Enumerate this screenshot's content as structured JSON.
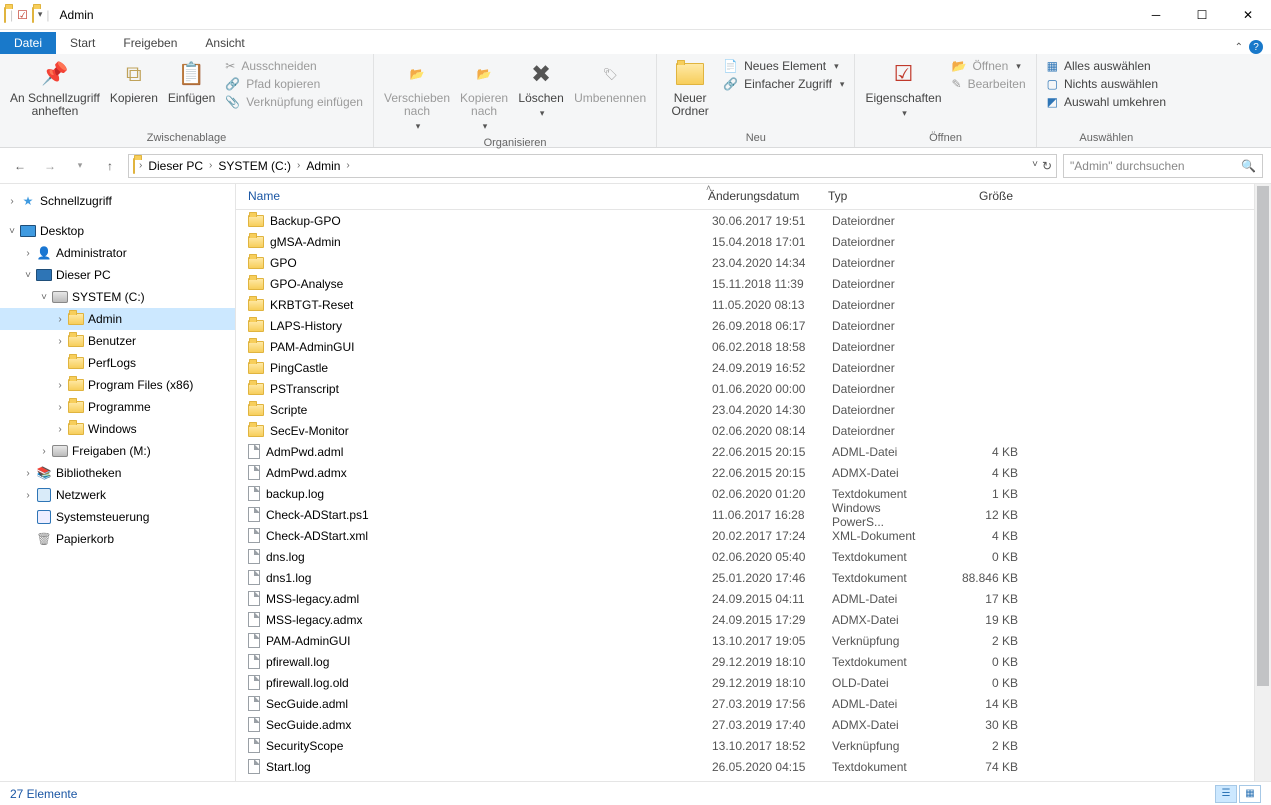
{
  "window": {
    "title": "Admin"
  },
  "tabs": {
    "file": "Datei",
    "start": "Start",
    "share": "Freigeben",
    "view": "Ansicht"
  },
  "ribbon": {
    "clipboard": {
      "label": "Zwischenablage",
      "pin": "An Schnellzugriff\nanheften",
      "copy": "Kopieren",
      "paste": "Einfügen",
      "cut": "Ausschneiden",
      "copypath": "Pfad kopieren",
      "pastesc": "Verknüpfung einfügen"
    },
    "organize": {
      "label": "Organisieren",
      "move": "Verschieben\nnach",
      "copyto": "Kopieren\nnach",
      "delete": "Löschen",
      "rename": "Umbenennen"
    },
    "new": {
      "label": "Neu",
      "newfolder": "Neuer\nOrdner",
      "newitem": "Neues Element",
      "easyaccess": "Einfacher Zugriff"
    },
    "open": {
      "label": "Öffnen",
      "props": "Eigenschaften",
      "open": "Öffnen",
      "edit": "Bearbeiten"
    },
    "select": {
      "label": "Auswählen",
      "all": "Alles auswählen",
      "none": "Nichts auswählen",
      "invert": "Auswahl umkehren"
    }
  },
  "breadcrumb": [
    "Dieser PC",
    "SYSTEM (C:)",
    "Admin"
  ],
  "search_placeholder": "\"Admin\" durchsuchen",
  "tree": [
    {
      "d": 1,
      "tw": ">",
      "ic": "star",
      "t": "Schnellzugriff"
    },
    {
      "gap": true
    },
    {
      "d": 1,
      "tw": "v",
      "ic": "desktop",
      "t": "Desktop"
    },
    {
      "d": 2,
      "tw": ">",
      "ic": "user",
      "t": "Administrator"
    },
    {
      "d": 2,
      "tw": "v",
      "ic": "pc",
      "t": "Dieser PC"
    },
    {
      "d": 3,
      "tw": "v",
      "ic": "disk",
      "t": "SYSTEM (C:)"
    },
    {
      "d": 4,
      "tw": ">",
      "ic": "folder",
      "t": "Admin",
      "sel": true
    },
    {
      "d": 4,
      "tw": ">",
      "ic": "folder",
      "t": "Benutzer"
    },
    {
      "d": 4,
      "tw": "",
      "ic": "folder",
      "t": "PerfLogs"
    },
    {
      "d": 4,
      "tw": ">",
      "ic": "folder",
      "t": "Program Files (x86)"
    },
    {
      "d": 4,
      "tw": ">",
      "ic": "folder",
      "t": "Programme"
    },
    {
      "d": 4,
      "tw": ">",
      "ic": "folder",
      "t": "Windows"
    },
    {
      "d": 3,
      "tw": ">",
      "ic": "disk",
      "t": "Freigaben (M:)"
    },
    {
      "d": 2,
      "tw": ">",
      "ic": "lib",
      "t": "Bibliotheken"
    },
    {
      "d": 2,
      "tw": ">",
      "ic": "net",
      "t": "Netzwerk"
    },
    {
      "d": 2,
      "tw": "",
      "ic": "ctrl",
      "t": "Systemsteuerung"
    },
    {
      "d": 2,
      "tw": "",
      "ic": "bin",
      "t": "Papierkorb"
    }
  ],
  "columns": {
    "name": "Name",
    "date": "Änderungsdatum",
    "type": "Typ",
    "size": "Größe"
  },
  "items": [
    {
      "ic": "folder",
      "n": "Backup-GPO",
      "d": "30.06.2017 19:51",
      "t": "Dateiordner",
      "s": ""
    },
    {
      "ic": "folder",
      "n": "gMSA-Admin",
      "d": "15.04.2018 17:01",
      "t": "Dateiordner",
      "s": ""
    },
    {
      "ic": "folder",
      "n": "GPO",
      "d": "23.04.2020 14:34",
      "t": "Dateiordner",
      "s": ""
    },
    {
      "ic": "folder",
      "n": "GPO-Analyse",
      "d": "15.11.2018 11:39",
      "t": "Dateiordner",
      "s": ""
    },
    {
      "ic": "folder",
      "n": "KRBTGT-Reset",
      "d": "11.05.2020 08:13",
      "t": "Dateiordner",
      "s": ""
    },
    {
      "ic": "folder",
      "n": "LAPS-History",
      "d": "26.09.2018 06:17",
      "t": "Dateiordner",
      "s": ""
    },
    {
      "ic": "folder",
      "n": "PAM-AdminGUI",
      "d": "06.02.2018 18:58",
      "t": "Dateiordner",
      "s": ""
    },
    {
      "ic": "folder",
      "n": "PingCastle",
      "d": "24.09.2019 16:52",
      "t": "Dateiordner",
      "s": ""
    },
    {
      "ic": "folder",
      "n": "PSTranscript",
      "d": "01.06.2020 00:00",
      "t": "Dateiordner",
      "s": ""
    },
    {
      "ic": "folder",
      "n": "Scripte",
      "d": "23.04.2020 14:30",
      "t": "Dateiordner",
      "s": ""
    },
    {
      "ic": "folder",
      "n": "SecEv-Monitor",
      "d": "02.06.2020 08:14",
      "t": "Dateiordner",
      "s": ""
    },
    {
      "ic": "file",
      "n": "AdmPwd.adml",
      "d": "22.06.2015 20:15",
      "t": "ADML-Datei",
      "s": "4 KB"
    },
    {
      "ic": "file",
      "n": "AdmPwd.admx",
      "d": "22.06.2015 20:15",
      "t": "ADMX-Datei",
      "s": "4 KB"
    },
    {
      "ic": "file",
      "n": "backup.log",
      "d": "02.06.2020 01:20",
      "t": "Textdokument",
      "s": "1 KB"
    },
    {
      "ic": "file",
      "n": "Check-ADStart.ps1",
      "d": "11.06.2017 16:28",
      "t": "Windows PowerS...",
      "s": "12 KB"
    },
    {
      "ic": "file",
      "n": "Check-ADStart.xml",
      "d": "20.02.2017 17:24",
      "t": "XML-Dokument",
      "s": "4 KB"
    },
    {
      "ic": "file",
      "n": "dns.log",
      "d": "02.06.2020 05:40",
      "t": "Textdokument",
      "s": "0 KB"
    },
    {
      "ic": "file",
      "n": "dns1.log",
      "d": "25.01.2020 17:46",
      "t": "Textdokument",
      "s": "88.846 KB"
    },
    {
      "ic": "file",
      "n": "MSS-legacy.adml",
      "d": "24.09.2015 04:11",
      "t": "ADML-Datei",
      "s": "17 KB"
    },
    {
      "ic": "file",
      "n": "MSS-legacy.admx",
      "d": "24.09.2015 17:29",
      "t": "ADMX-Datei",
      "s": "19 KB"
    },
    {
      "ic": "file",
      "n": "PAM-AdminGUI",
      "d": "13.10.2017 19:05",
      "t": "Verknüpfung",
      "s": "2 KB"
    },
    {
      "ic": "file",
      "n": "pfirewall.log",
      "d": "29.12.2019 18:10",
      "t": "Textdokument",
      "s": "0 KB"
    },
    {
      "ic": "file",
      "n": "pfirewall.log.old",
      "d": "29.12.2019 18:10",
      "t": "OLD-Datei",
      "s": "0 KB"
    },
    {
      "ic": "file",
      "n": "SecGuide.adml",
      "d": "27.03.2019 17:56",
      "t": "ADML-Datei",
      "s": "14 KB"
    },
    {
      "ic": "file",
      "n": "SecGuide.admx",
      "d": "27.03.2019 17:40",
      "t": "ADMX-Datei",
      "s": "30 KB"
    },
    {
      "ic": "file",
      "n": "SecurityScope",
      "d": "13.10.2017 18:52",
      "t": "Verknüpfung",
      "s": "2 KB"
    },
    {
      "ic": "file",
      "n": "Start.log",
      "d": "26.05.2020 04:15",
      "t": "Textdokument",
      "s": "74 KB"
    }
  ],
  "status": "27 Elemente"
}
